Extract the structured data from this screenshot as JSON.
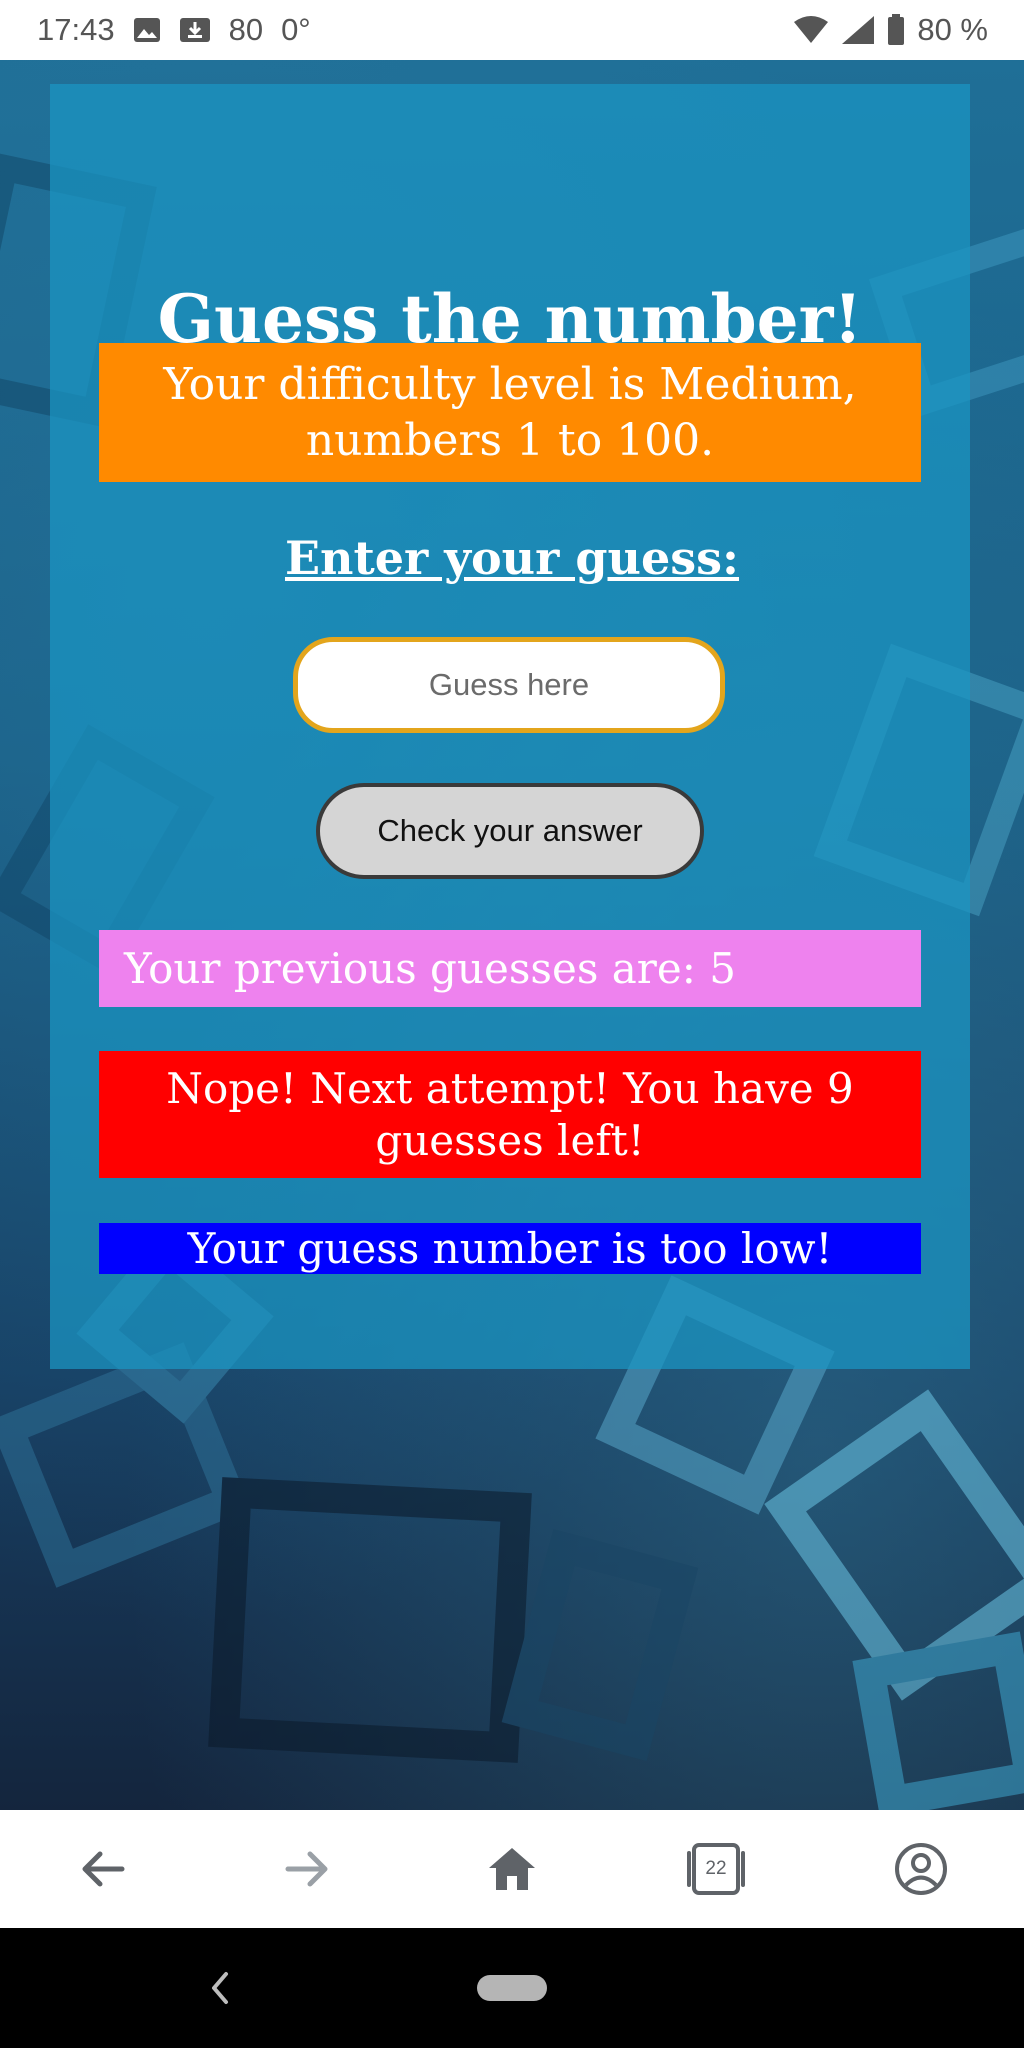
{
  "status_bar": {
    "time": "17:43",
    "notification_count": "80",
    "temperature": "0°",
    "battery": "80 %"
  },
  "game": {
    "title": "Guess the number!",
    "difficulty_text": "Your difficulty level is Medium, numbers 1 to 100.",
    "enter_label": "Enter your guess:",
    "input_placeholder": "Guess here",
    "input_value": "",
    "check_button_label": "Check your answer",
    "previous_guesses": "Your previous guesses are: 5",
    "feedback_attempts": "Nope! Next attempt! You have 9 guesses left!",
    "feedback_hint": "Your guess number is too low!"
  },
  "toolbar": {
    "tab_count": "22",
    "icons": [
      "back-arrow-icon",
      "forward-arrow-icon",
      "home-icon",
      "tabs-icon",
      "account-icon"
    ]
  },
  "colors": {
    "difficulty_bg": "#ff8a00",
    "previous_bg": "#ee82ee",
    "nope_bg": "#ff0000",
    "hint_bg": "#0000ff",
    "input_border": "#e3a51c",
    "button_bg": "#d5d5d5"
  }
}
